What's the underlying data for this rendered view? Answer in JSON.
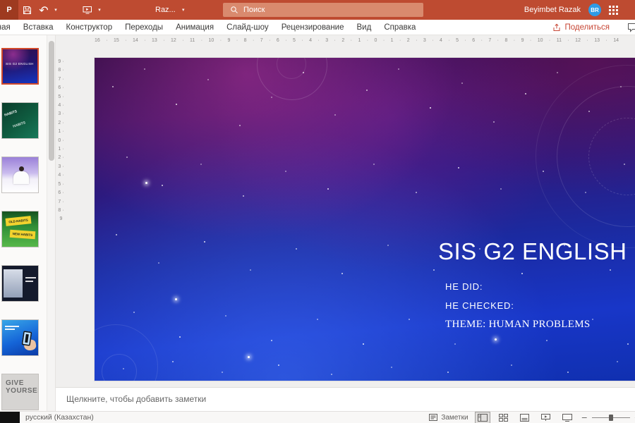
{
  "icons": {
    "app_logo": "P",
    "caret": "▾",
    "undo": "↶",
    "minus": "−",
    "plus": "+"
  },
  "title_bar": {
    "document_name": "Raz...",
    "search_placeholder": "Поиск",
    "user_name": "Beyimbet Razak",
    "user_initials": "BR"
  },
  "ribbon_tabs": [
    {
      "id": "home",
      "label": "Главная"
    },
    {
      "id": "insert",
      "label": "Вставка"
    },
    {
      "id": "design",
      "label": "Конструктор"
    },
    {
      "id": "transitions",
      "label": "Переходы"
    },
    {
      "id": "animations",
      "label": "Анимация"
    },
    {
      "id": "slideshow",
      "label": "Слайд-шоу"
    },
    {
      "id": "review",
      "label": "Рецензирование"
    },
    {
      "id": "view",
      "label": "Вид"
    },
    {
      "id": "help",
      "label": "Справка"
    }
  ],
  "share_button_label": "Поделиться",
  "slides": [
    {
      "text": "SIS G2 ENGLISH"
    },
    {
      "text": "HABITS"
    },
    {
      "text": ""
    },
    {
      "text_top": "OLD HABITS",
      "text_bottom": "NEW HABITS"
    },
    {
      "text": ""
    },
    {
      "text": ""
    },
    {
      "text": "GIVE\nYOURSELF"
    }
  ],
  "rulers": {
    "horizontal": "16 · 15 · 14 · 13 · 12 · 11 · 10 · 9 · 8 · 7 · 6 · 5 · 4 · 3 · 2 · 1 · 0 · 1 · 2 · 3 · 4 · 5 · 6 · 7 · 8 · 9 · 10 · 11 · 12 · 13 · 14",
    "vertical": "9 · 8 · 7 · 6 · 5 · 4 · 3 · 2 · 1 · 0 · 1 · 2 · 3 · 4 · 5 · 6 · 7 · 8 · 9"
  },
  "slide_canvas": {
    "title": "SIS G2 ENGLISH",
    "line1": "HE DID:",
    "line2": "HE CHECKED:",
    "line3": "THEME: HUMAN PROBLEMS"
  },
  "notes_panel": {
    "placeholder": "Щелкните, чтобы добавить заметки"
  },
  "status_bar": {
    "language": "русский (Казахстан)",
    "notes_toggle_label": "Заметки"
  }
}
